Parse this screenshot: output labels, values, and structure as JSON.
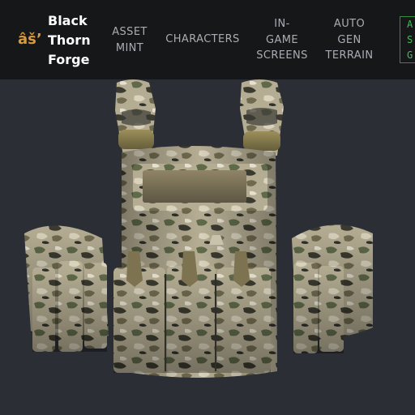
{
  "brand": {
    "icon_glyph": "âš’",
    "name": "Black Thorn Forge"
  },
  "nav": {
    "items": [
      {
        "label": "ASSET\nMINT"
      },
      {
        "label": "CHARACTERS"
      },
      {
        "label": "IN-\nGAME\nSCREENS"
      },
      {
        "label": "AUTO\nGEN\nTERRAIN"
      }
    ],
    "cta_label": "A\nS\nG"
  },
  "colors": {
    "navbar_bg": "#161718",
    "stage_bg": "#2b2e35",
    "brand_icon": "#d79a3c",
    "nav_text": "#a9adb3",
    "cta_green": "#3fbf55"
  },
  "viewer": {
    "subject": "multicam-plate-carrier-vest-3d-model"
  }
}
